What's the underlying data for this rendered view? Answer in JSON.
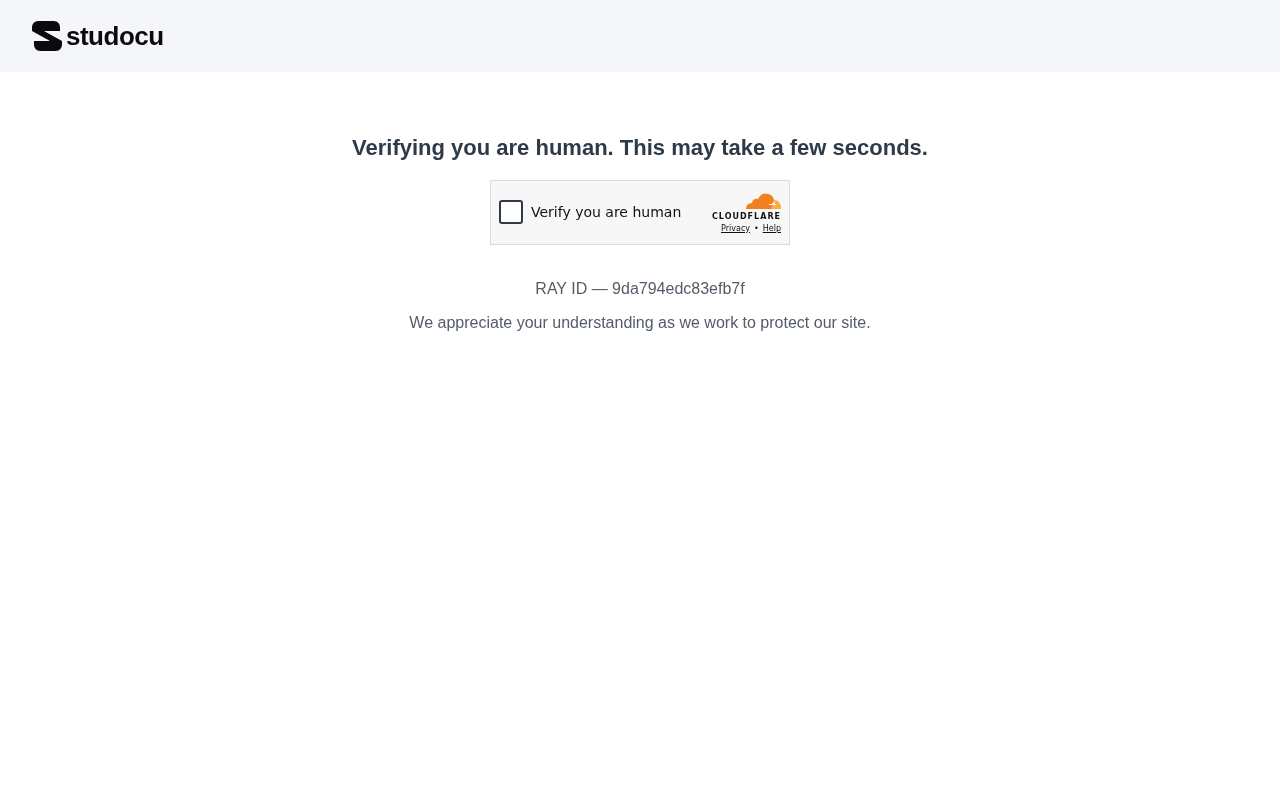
{
  "header": {
    "logo_text": "studocu"
  },
  "heading": "Verifying you are human. This may take a few seconds.",
  "challenge": {
    "checked": false,
    "label": "Verify you are human",
    "brand": "CLOUDFLARE",
    "links": [
      "Privacy",
      "Help"
    ],
    "separator": "•"
  },
  "ray_id": "RAY ID — 9da794edc83efb7f",
  "message": "We appreciate your understanding as we work to protect our site."
}
